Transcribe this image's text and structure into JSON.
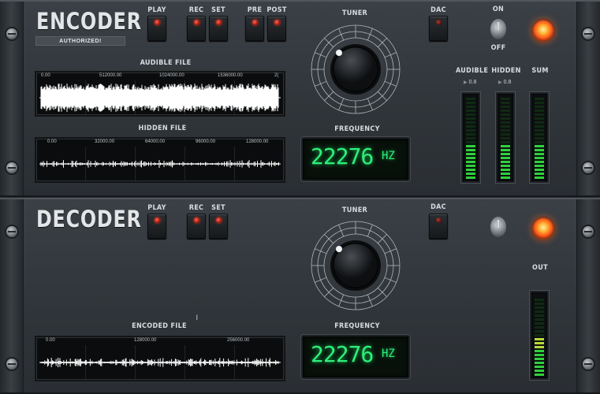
{
  "encoder": {
    "title": "ENCODER",
    "badge": "AUTHORIZED!",
    "labels": {
      "play": "PLAY",
      "rec": "REC",
      "set": "SET",
      "pre": "PRE",
      "post": "POST",
      "tuner": "TUNER",
      "dac": "DAC",
      "on": "ON",
      "off": "OFF",
      "audible_file": "AUDIBLE FILE",
      "hidden_file": "HIDDEN FILE",
      "frequency": "FREQUENCY",
      "audible": "AUDIBLE",
      "hidden": "HIDDEN",
      "sum": "SUM"
    },
    "audible_ticks": [
      "0.00",
      "512000.00",
      "1024000.00",
      "1536000.00",
      "2("
    ],
    "hidden_ticks": [
      "0.00",
      "32000.00",
      "64000.00",
      "96000.00",
      "128000.00"
    ],
    "frequency_value": "22276",
    "frequency_unit": "HZ",
    "audible_level": "0.8",
    "hidden_level": "0.8",
    "meters": {
      "audible": 0.45,
      "hidden": 0.45,
      "sum": 0.45
    },
    "play_lit": true
  },
  "decoder": {
    "title": "DECODER",
    "labels": {
      "play": "PLAY",
      "rec": "REC",
      "set": "SET",
      "tuner": "TUNER",
      "dac": "DAC",
      "encoded_file": "ENCODED FILE",
      "frequency": "FREQUENCY",
      "out": "OUT"
    },
    "encoded_ticks": [
      "0.00",
      "128000.00",
      "256000.00"
    ],
    "frequency_value": "22276",
    "frequency_unit": "HZ",
    "meters": {
      "out": 0.52
    },
    "cursor_mark": "I"
  },
  "colors": {
    "led_green": "#2ef07a",
    "meter_green": "#2fd13b",
    "lamp": "#ff6a22",
    "button_led": "#ff3a22"
  }
}
